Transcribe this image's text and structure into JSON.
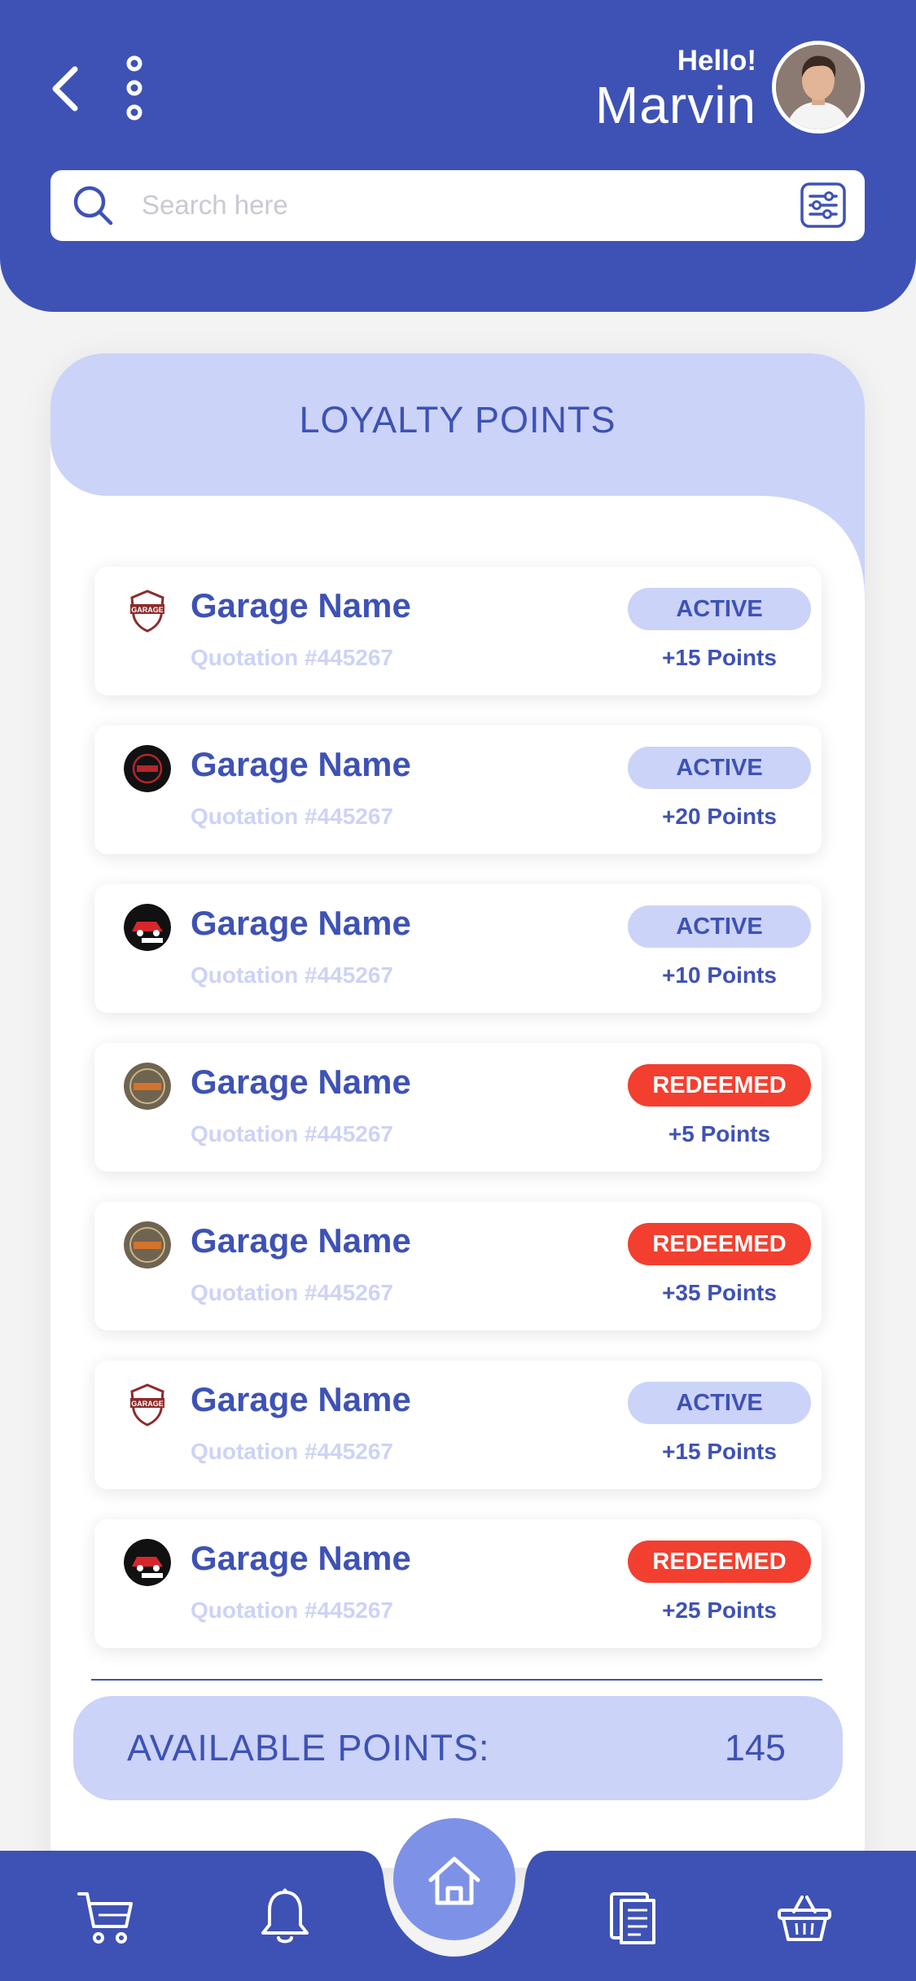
{
  "header": {
    "greeting": "Hello!",
    "user_name": "Marvin"
  },
  "search": {
    "placeholder": "Search here"
  },
  "loyalty": {
    "title": "LOYALTY POINTS",
    "items": [
      {
        "garage": "Garage Name",
        "quotation": "Quotation #445267",
        "status": "ACTIVE",
        "points": "+15 Points",
        "logo": "garage-shield-logo"
      },
      {
        "garage": "Garage Name",
        "quotation": "Quotation #445267",
        "status": "ACTIVE",
        "points": "+20 Points",
        "logo": "garage-dark-logo"
      },
      {
        "garage": "Garage Name",
        "quotation": "Quotation #445267",
        "status": "ACTIVE",
        "points": "+10 Points",
        "logo": "car-service-logo"
      },
      {
        "garage": "Garage Name",
        "quotation": "Quotation #445267",
        "status": "REDEEMED",
        "points": "+5 Points",
        "logo": "garage-service-badge-logo"
      },
      {
        "garage": "Garage Name",
        "quotation": "Quotation #445267",
        "status": "REDEEMED",
        "points": "+35 Points",
        "logo": "garage-service-badge-logo"
      },
      {
        "garage": "Garage Name",
        "quotation": "Quotation #445267",
        "status": "ACTIVE",
        "points": "+15 Points",
        "logo": "garage-shield-logo"
      },
      {
        "garage": "Garage Name",
        "quotation": "Quotation #445267",
        "status": "REDEEMED",
        "points": "+25 Points",
        "logo": "car-service-logo"
      }
    ]
  },
  "available": {
    "label": "AVAILABLE POINTS:",
    "value": "145"
  },
  "nav": {
    "items": [
      "cart-icon",
      "bell-icon",
      "home-icon",
      "documents-icon",
      "basket-icon"
    ],
    "active": "home-icon"
  },
  "colors": {
    "primary": "#3e52b5",
    "light": "#cbd3f8",
    "redeemed": "#f23f2f",
    "home_button": "#7d92e6"
  }
}
